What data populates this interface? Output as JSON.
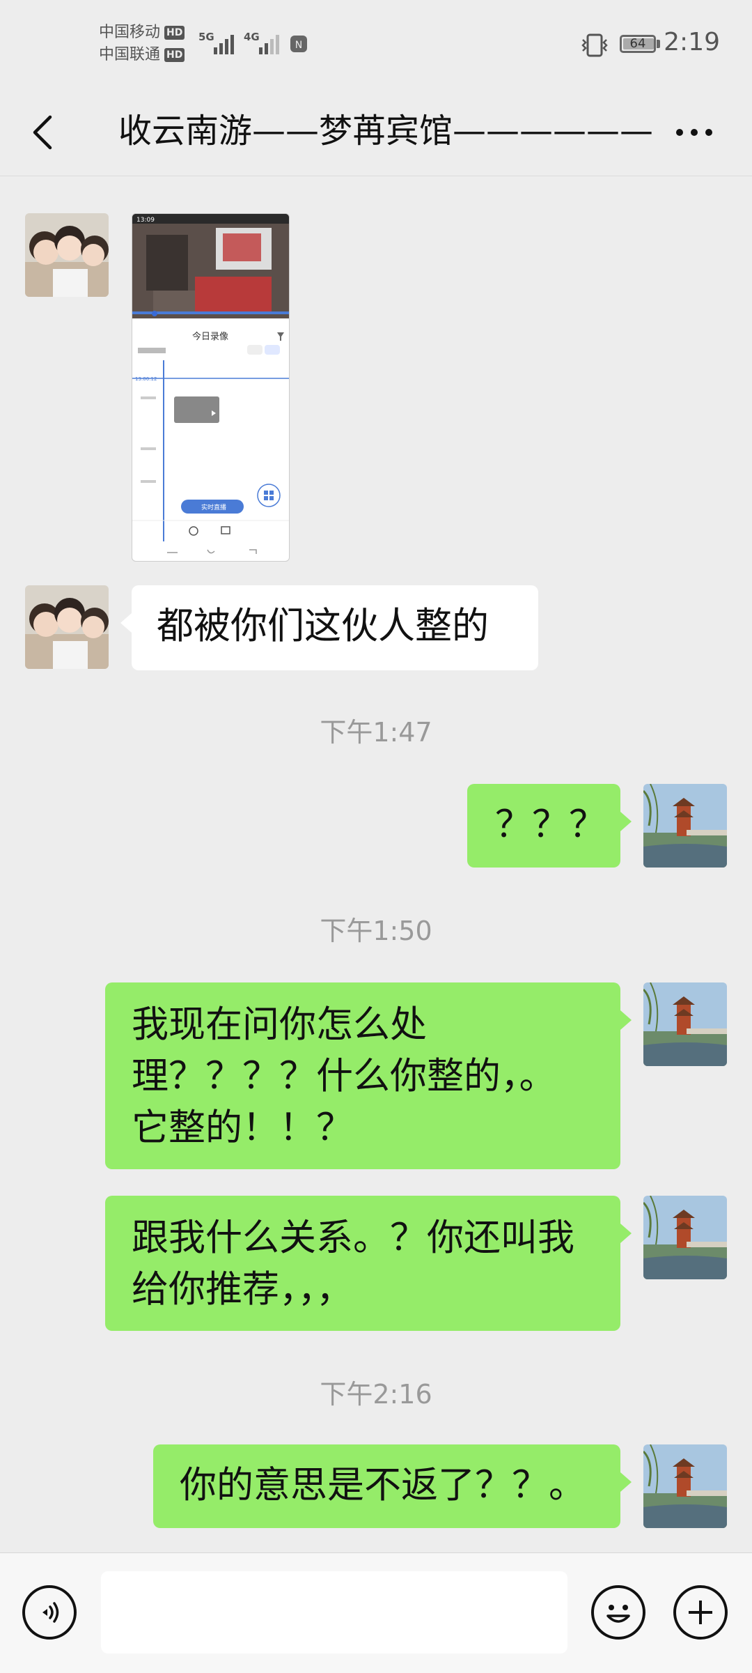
{
  "status_bar": {
    "carrier1": "中国移动",
    "carrier2": "中国联通",
    "hd": "HD",
    "net1": "5G",
    "net2": "4G",
    "battery": "64",
    "time": "2:19"
  },
  "header": {
    "title": "收云南游——梦苒宾馆——————"
  },
  "thumbnail": {
    "clock": "13:09",
    "heading": "今日录像",
    "time_marker": "13:00:12",
    "play_label": "实时直播"
  },
  "messages": [
    {
      "side": "left",
      "type": "image"
    },
    {
      "side": "left",
      "type": "text",
      "text": "都被你们这伙人整的"
    },
    {
      "type": "timestamp",
      "text": "下午1:47"
    },
    {
      "side": "right",
      "type": "text",
      "text": "？？？"
    },
    {
      "type": "timestamp",
      "text": "下午1:50"
    },
    {
      "side": "right",
      "type": "text",
      "lines": [
        "我现在问你怎么处",
        "理？？？？什么你整的，。",
        "它整的！！？"
      ]
    },
    {
      "side": "right",
      "type": "text",
      "lines": [
        "跟我什么关系。？你还叫我",
        "给你推荐，，，"
      ]
    },
    {
      "type": "timestamp",
      "text": "下午2:16"
    },
    {
      "side": "right",
      "type": "text",
      "text": "你的意思是不返了？？。"
    }
  ],
  "input_bar": {
    "text_value": ""
  },
  "colors": {
    "background": "#ededed",
    "sent_bubble": "#95ec69",
    "received_bubble": "#ffffff"
  }
}
